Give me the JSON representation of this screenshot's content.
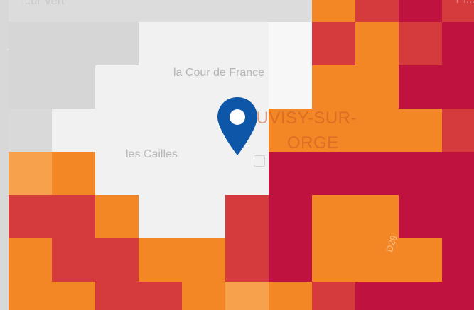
{
  "colors": {
    "light_gray": "#f1f1f1",
    "mid_gray": "#dedede",
    "pale_white": "#f7f7f7",
    "light_orange": "#f6a14b",
    "orange": "#f38725",
    "dark_orange": "#ee7622",
    "red": "#d53a3d",
    "dark_red": "#c0123f",
    "pin_blue": "#0e56a7"
  },
  "map": {
    "labels": [
      {
        "id": "cour-de-france",
        "text": "la Cour de France"
      },
      {
        "id": "juvisy",
        "text": "JUVISY-SUR-"
      },
      {
        "id": "orge",
        "text": "ORGE"
      },
      {
        "id": "cailles",
        "text": "les Cailles"
      },
      {
        "id": "top-left",
        "text": "...ur Vert"
      },
      {
        "id": "top-right",
        "text": "Pi..."
      }
    ],
    "road_label": "D29"
  }
}
